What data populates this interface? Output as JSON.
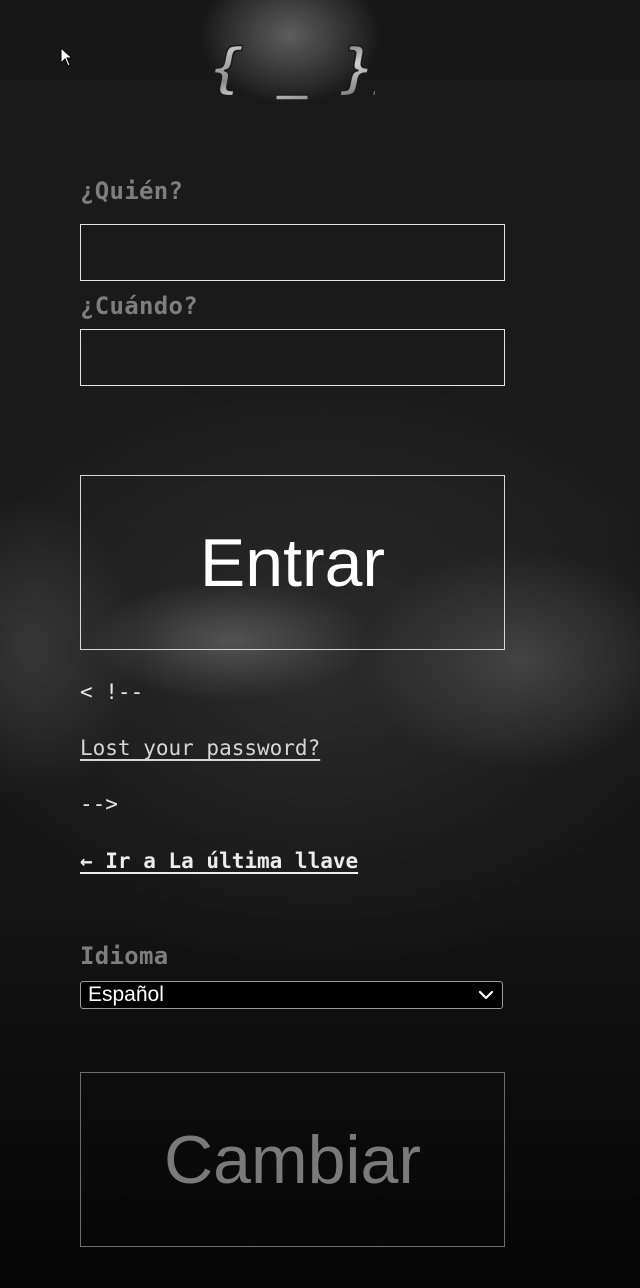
{
  "logo": {
    "text": "{{ _ }}"
  },
  "login": {
    "user_label": "¿Quién?",
    "user_value": "",
    "password_label": "¿Cuándo?",
    "password_value": "",
    "submit_label": "Entrar"
  },
  "comments": {
    "open": "< !--",
    "lost_password": "Lost your password?",
    "close": "-->"
  },
  "back_link": "← Ir a La última llave",
  "language": {
    "label": "Idioma",
    "selected": "Español",
    "change_label": "Cambiar"
  },
  "colors": {
    "label": "#7e7e7e",
    "text": "#e6e6e6",
    "border": "#e6e6e6",
    "background": "#1a1a1a"
  },
  "icons": [
    "cursor-icon",
    "chevron-down-icon"
  ]
}
